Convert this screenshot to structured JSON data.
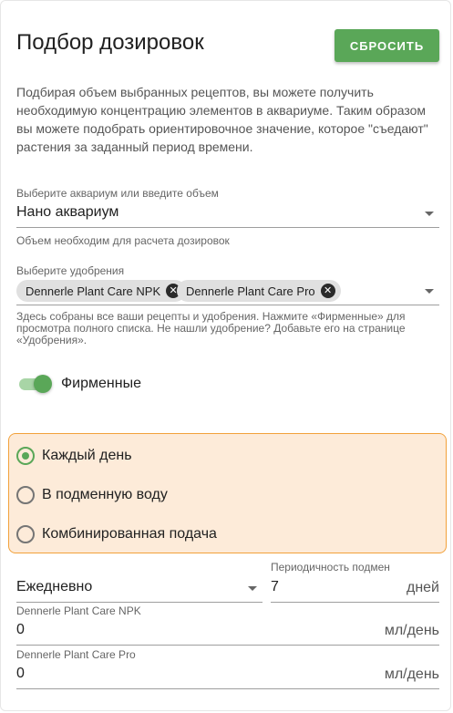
{
  "header": {
    "title": "Подбор дозировок",
    "reset_label": "СБРОСИТЬ"
  },
  "description": "Подбирая объем выбранных рецептов, вы можете получить необходимую концентрацию элементов в аквариуме. Таким образом вы можете подобрать ориентировочное значение, которое \"съедают\" растения за заданный период времени.",
  "aquarium": {
    "label": "Выберите аквариум или введите объем",
    "value": "Нано аквариум",
    "hint": "Объем необходим для расчета дозировок"
  },
  "fertilizers": {
    "label": "Выберите удобрения",
    "chips": [
      "Dennerle Plant Care NPK",
      "Dennerle Plant Care Pro"
    ],
    "hint": "Здесь собраны все ваши рецепты и удобрения. Нажмите «Фирменные» для просмотра полного списка. Не нашли удобрение? Добавьте его на странице «Удобрения»."
  },
  "brand_switch": {
    "label": "Фирменные",
    "on": true
  },
  "dosing_mode": {
    "options": [
      "Каждый день",
      "В подменную воду",
      "Комбинированная подача"
    ],
    "selected_index": 0
  },
  "frequency": {
    "value": "Ежедневно"
  },
  "water_change": {
    "label": "Периодичность подмен",
    "value": "7",
    "suffix": "дней"
  },
  "doses": [
    {
      "label": "Dennerle Plant Care NPK",
      "value": "0",
      "suffix": "мл/день"
    },
    {
      "label": "Dennerle Plant Care Pro",
      "value": "0",
      "suffix": "мл/день"
    }
  ],
  "colors": {
    "accent": "#5aa758",
    "highlight_bg": "#fdebd9",
    "highlight_border": "#f2a13a"
  }
}
